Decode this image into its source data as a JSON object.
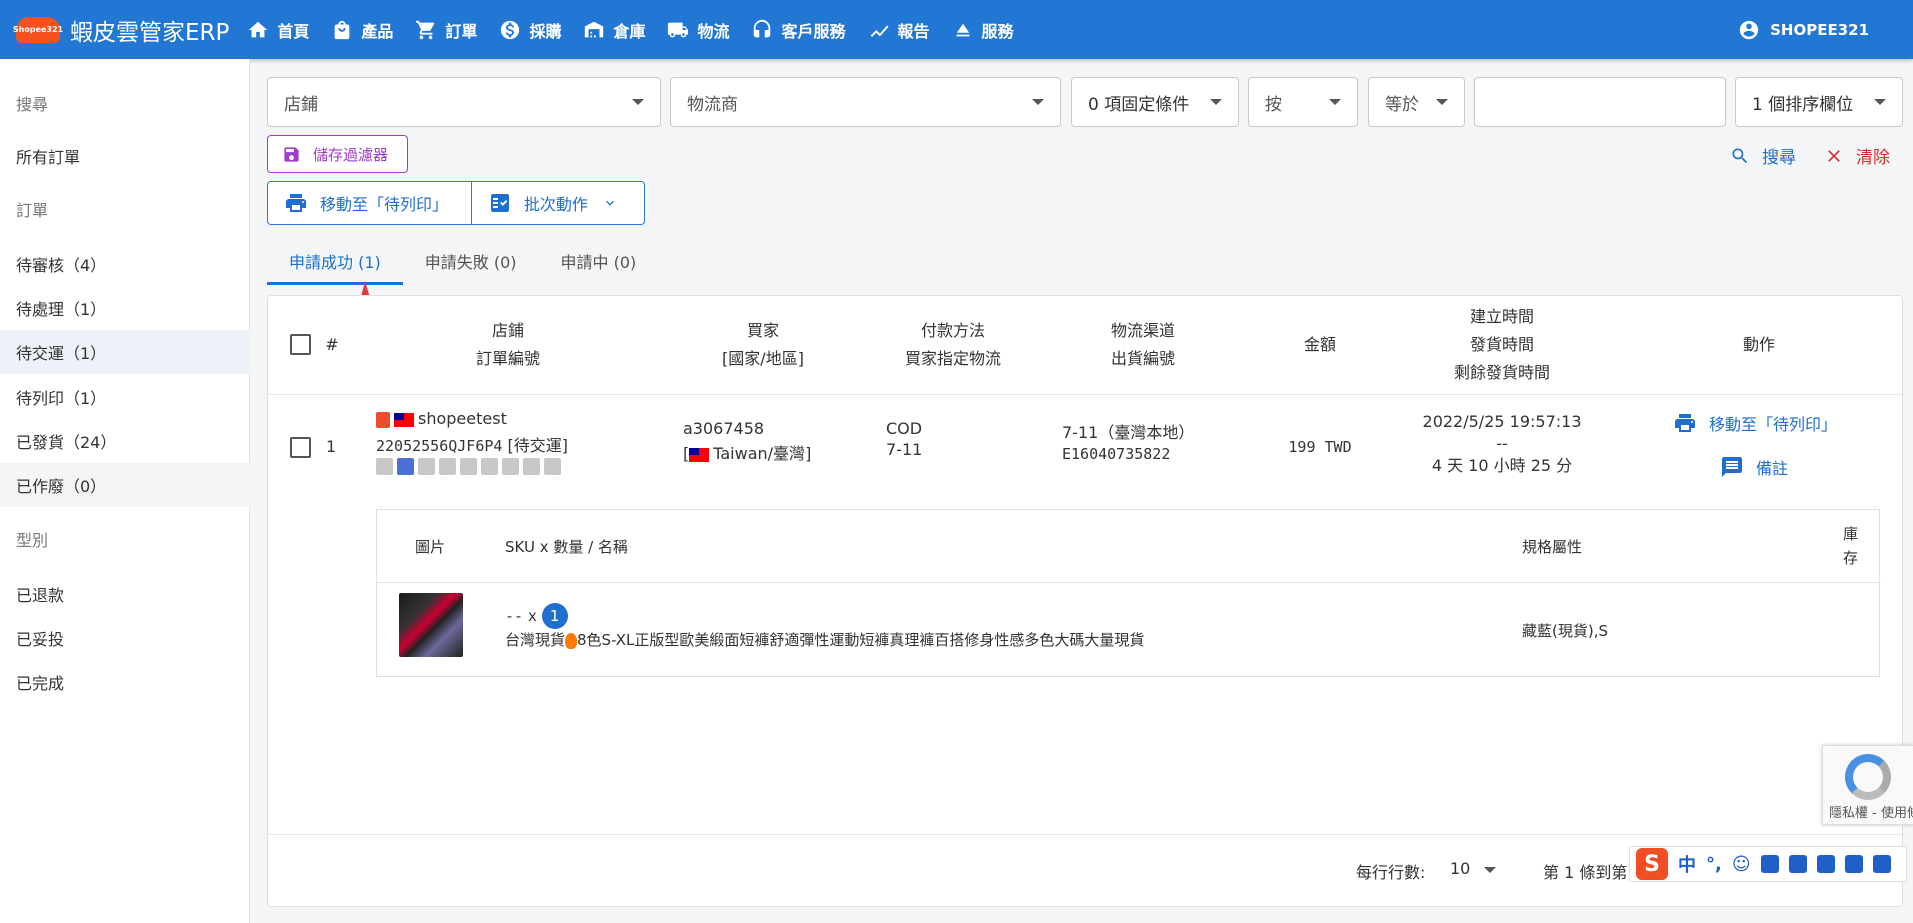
{
  "topbar": {
    "brand_badge": "Shopee321",
    "brand": "蝦皮雲管家ERP",
    "nav": [
      {
        "label": "首頁",
        "icon": "home-icon"
      },
      {
        "label": "產品",
        "icon": "shopping-bag-icon"
      },
      {
        "label": "訂單",
        "icon": "cart-icon"
      },
      {
        "label": "採購",
        "icon": "dollar-icon"
      },
      {
        "label": "倉庫",
        "icon": "warehouse-icon"
      },
      {
        "label": "物流",
        "icon": "truck-icon"
      },
      {
        "label": "客戶服務",
        "icon": "headset-icon"
      },
      {
        "label": "報告",
        "icon": "chart-icon"
      },
      {
        "label": "服務",
        "icon": "eject-icon"
      }
    ],
    "user": "SHOPEE321",
    "colors": {
      "bar": "#2277d5"
    }
  },
  "sidebar": {
    "items": [
      {
        "label": "搜尋",
        "type": "header"
      },
      {
        "label": "所有訂單",
        "type": "item"
      },
      {
        "label": "訂單",
        "type": "header"
      },
      {
        "label": "待審核（4）",
        "type": "item"
      },
      {
        "label": "待處理（1）",
        "type": "item"
      },
      {
        "label": "待交運（1）",
        "type": "active"
      },
      {
        "label": "待列印（1）",
        "type": "item"
      },
      {
        "label": "已發貨（24）",
        "type": "item"
      },
      {
        "label": "已作廢（0）",
        "type": "highlight"
      },
      {
        "label": "型別",
        "type": "header"
      },
      {
        "label": "已退款",
        "type": "item"
      },
      {
        "label": "已妥投",
        "type": "item"
      },
      {
        "label": "已完成",
        "type": "item"
      }
    ]
  },
  "filters": {
    "store": "店鋪",
    "carrier": "物流商",
    "fixed_conditions": "0 項固定條件",
    "by": "按",
    "equals": "等於",
    "value": "",
    "sort_fields": "1 個排序欄位"
  },
  "actions": {
    "save_filter": "儲存過濾器",
    "search": "搜尋",
    "clear": "清除",
    "move_to_print": "移動至「待列印」",
    "batch": "批次動作"
  },
  "tabs": [
    {
      "label": "申請成功 (1)",
      "active": true
    },
    {
      "label": "申請失敗 (0)",
      "active": false
    },
    {
      "label": "申請中 (0)",
      "active": false
    }
  ],
  "table": {
    "headers": {
      "index": "#",
      "store_l1": "店鋪",
      "store_l2": "訂單編號",
      "buyer_l1": "買家",
      "buyer_l2": "[國家/地區]",
      "pay_l1": "付款方法",
      "pay_l2": "買家指定物流",
      "ship_l1": "物流渠道",
      "ship_l2": "出貨編號",
      "amount": "金額",
      "time_l1": "建立時間",
      "time_l2": "發貨時間",
      "time_l3": "剩餘發貨時間",
      "action": "動作"
    },
    "row": {
      "index": "1",
      "store": "shopeetest",
      "order_no": "22052556QJF6P4",
      "status_tag": "[待交運]",
      "buyer": "a3067458",
      "buyer_country": "Taiwan/臺灣",
      "pay_method": "COD",
      "pay_logistics": "7-11",
      "channel": "7-11（臺灣本地）",
      "ship_no": "E16040735822",
      "amount": "199 TWD",
      "created": "2022/5/25 19:57:13",
      "shipped": "--",
      "remaining": "4 天 10 小時 25 分",
      "action_print": "移動至「待列印」",
      "action_note": "備註"
    },
    "sub": {
      "headers": {
        "image": "圖片",
        "sku": "SKU x 數量 / 名稱",
        "spec": "規格屬性",
        "stock_l1": "庫",
        "stock_l2": "存"
      },
      "item": {
        "sku": "--",
        "x": "x",
        "qty": "1",
        "name_pre": "台灣現貨",
        "name_post": "8色S-XL正版型歐美緞面短褲舒適彈性運動短褲真理褲百搭修身性感多色大碼大量現貨",
        "spec": "藏藍(現貨),S"
      }
    }
  },
  "pager": {
    "rows_label": "每行行數:",
    "rows_value": "10",
    "range": "第 1 條到第"
  },
  "ime": {
    "brand": "S",
    "zh": "中",
    "punct": "°,"
  },
  "recaptcha": {
    "text": "隱私權 - 使用條款"
  }
}
